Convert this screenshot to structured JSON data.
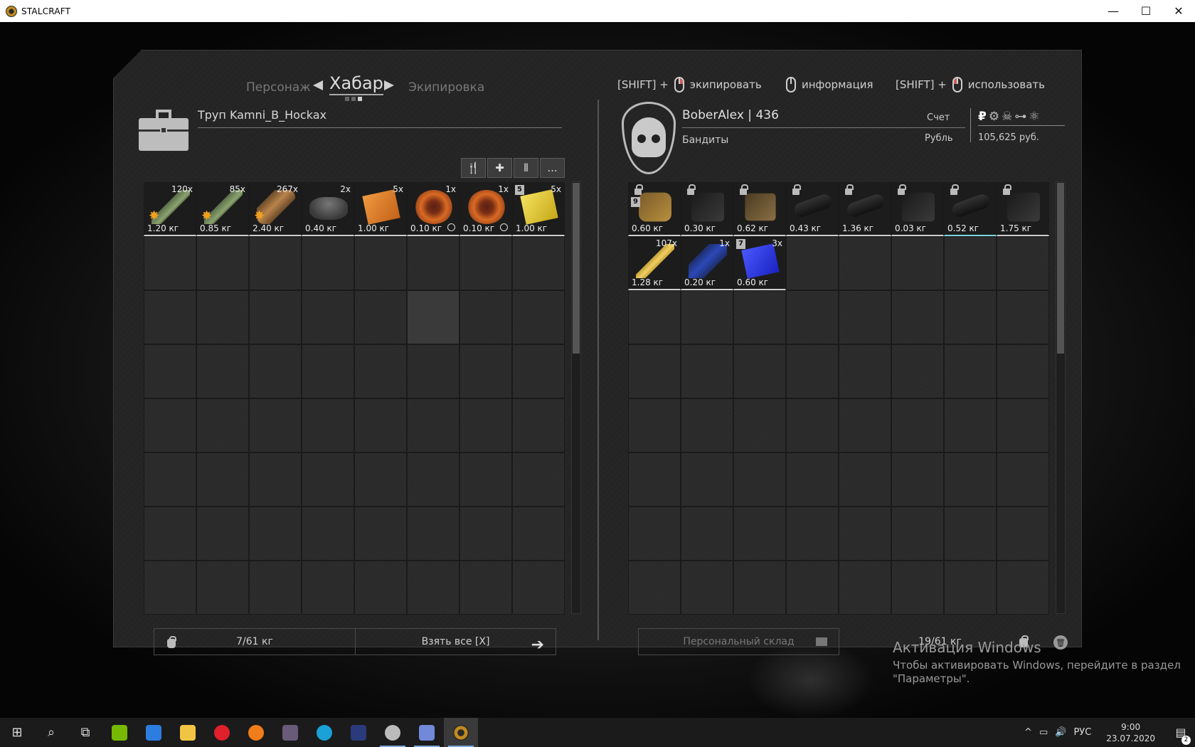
{
  "window": {
    "title": "STALCRAFT",
    "minimize": "—",
    "maximize": "☐",
    "close": "✕"
  },
  "nav": {
    "prev": "Персонаж",
    "current": "Хабар",
    "next": "Экипировка"
  },
  "hints": {
    "equip_mod": "[SHIFT] +",
    "equip": "экипировать",
    "info": "информация",
    "use_mod": "[SHIFT] +",
    "use": "использовать"
  },
  "left": {
    "container_name": "Труп Kamni_B_Hockax",
    "filters": {
      "food": "🍴",
      "medkit": "✚",
      "ammo": "⦀",
      "more": "..."
    },
    "items": [
      {
        "count": "120x",
        "weight": "1.20 кг",
        "art": "grenade"
      },
      {
        "count": "85x",
        "weight": "0.85 кг",
        "art": "grenade"
      },
      {
        "count": "267x",
        "weight": "2.40 кг",
        "art": "shell"
      },
      {
        "count": "2x",
        "weight": "0.40 кг",
        "art": "tape"
      },
      {
        "count": "5x",
        "weight": "1.00 кг",
        "art": "orange-box"
      },
      {
        "count": "1x",
        "weight": "0.10 кг",
        "art": "artifact",
        "timer": true
      },
      {
        "count": "1x",
        "weight": "0.10 кг",
        "art": "artifact",
        "timer": true
      },
      {
        "count": "5x",
        "weight": "1.00 кг",
        "art": "yellow-box",
        "level": "5"
      }
    ],
    "weight": "7/61 кг",
    "take_all": "Взять все [X]"
  },
  "right": {
    "player_name": "BoberAlex",
    "player_level": "436",
    "faction": "Бандиты",
    "account_label": "Счет",
    "currency_label": "Рубль",
    "currency_icon": "₽",
    "money": "105,625 руб.",
    "items": [
      {
        "count": "",
        "weight": "0.60 кг",
        "art": "glove",
        "locked": true,
        "level": "9"
      },
      {
        "count": "",
        "weight": "0.30 кг",
        "art": "dark-gear",
        "locked": true
      },
      {
        "count": "",
        "weight": "0.62 кг",
        "art": "tan-gear",
        "locked": true
      },
      {
        "count": "",
        "weight": "0.43 кг",
        "art": "tube",
        "locked": true
      },
      {
        "count": "",
        "weight": "1.36 кг",
        "art": "tube",
        "locked": true
      },
      {
        "count": "",
        "weight": "0.03 кг",
        "art": "dark-gear",
        "locked": true
      },
      {
        "count": "",
        "weight": "0.52 кг",
        "art": "tube",
        "locked": true,
        "cyan": true
      },
      {
        "count": "",
        "weight": "1.75 кг",
        "art": "dark-gear",
        "locked": true
      },
      {
        "count": "107x",
        "weight": "1.28 кг",
        "art": "bullet"
      },
      {
        "count": "1x",
        "weight": "0.20 кг",
        "art": "bottle"
      },
      {
        "count": "3x",
        "weight": "0.60 кг",
        "art": "blue-box",
        "level": "7"
      }
    ],
    "personal_storage": "Персональный склад",
    "weight": "19/61 кг"
  },
  "watermark": {
    "title": "Активация Windows",
    "line1": "Чтобы активировать Windows, перейдите в раздел",
    "line2": "\"Параметры\"."
  },
  "taskbar": {
    "lang": "РУС",
    "time": "9:00",
    "date": "23.07.2020",
    "notifications": "2"
  }
}
